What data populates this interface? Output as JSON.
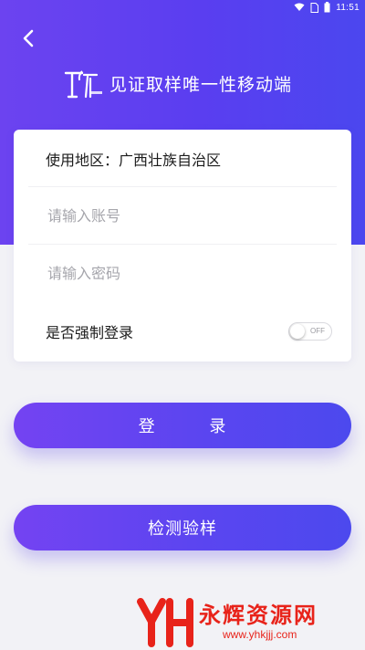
{
  "status_bar": {
    "time": "11:51",
    "icons": [
      "wifi-icon",
      "sim-icon",
      "battery-icon"
    ]
  },
  "header": {
    "back_icon": "chevron-left-icon",
    "title": "见证取样唯一性移动端"
  },
  "form": {
    "region_label": "使用地区：",
    "region_value": "广西壮族自治区",
    "account_placeholder": "请输入账号",
    "password_placeholder": "请输入密码",
    "force_login_label": "是否强制登录",
    "force_login_state": "OFF"
  },
  "buttons": {
    "login_label": "登 录",
    "check_label": "检测验样"
  },
  "watermark": {
    "title": "永辉资源网",
    "url": "www.yhkjjj.com"
  },
  "colors": {
    "primary": "#5a3ef0",
    "primary_gradient_start": "#7443f2",
    "primary_gradient_end": "#4c49ee",
    "page_background": "#f2f2f6",
    "watermark": "#e8231a"
  }
}
